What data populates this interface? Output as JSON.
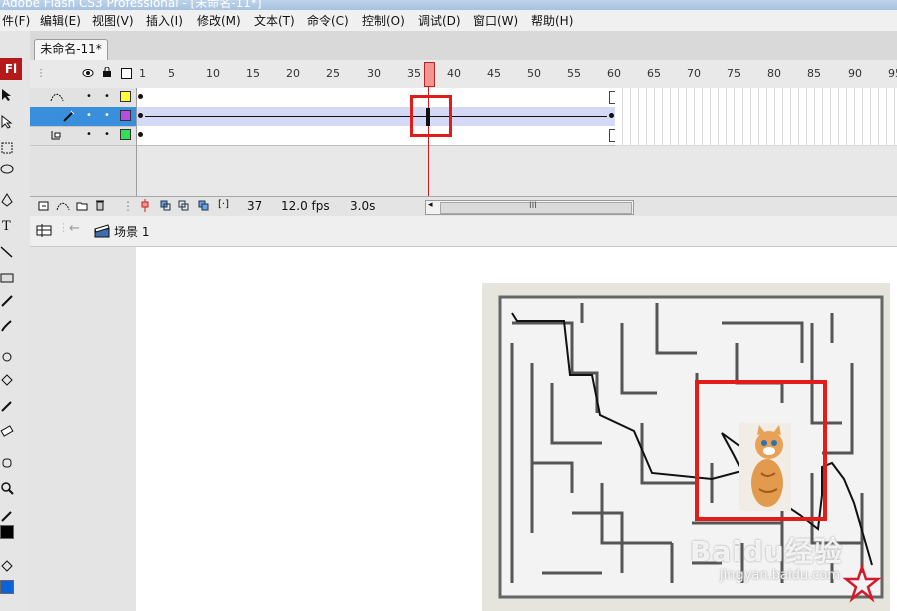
{
  "window": {
    "title": "Adobe Flash CS3 Professional - [未命名-11*]"
  },
  "menu": {
    "items": [
      "件(F)",
      "编辑(E)",
      "视图(V)",
      "插入(I)",
      "修改(M)",
      "文本(T)",
      "命令(C)",
      "控制(O)",
      "调试(D)",
      "窗口(W)",
      "帮助(H)"
    ]
  },
  "toolbox": {
    "logo": "Fl",
    "tools": [
      "selection-icon",
      "subselection-icon",
      "free-transform-icon",
      "lasso-icon",
      "pen-icon",
      "text-icon",
      "line-icon",
      "rectangle-icon",
      "pencil-icon",
      "brush-icon",
      "ink-bottle-icon",
      "paint-bucket-icon",
      "eyedropper-icon",
      "eraser-icon",
      "hand-icon",
      "zoom-icon"
    ]
  },
  "document": {
    "tab_label": "未命名-11*"
  },
  "timeline": {
    "ruler": [
      "1",
      "5",
      "10",
      "15",
      "20",
      "25",
      "30",
      "35",
      "40",
      "45",
      "50",
      "55",
      "60",
      "65",
      "70",
      "75",
      "80",
      "85",
      "90",
      "95"
    ],
    "current_frame": "37",
    "fps": "12.0 fps",
    "time": "3.0s",
    "scroll_mark": "III",
    "layers": [
      {
        "icon": "motion-guide-icon",
        "color": "#ffff33",
        "selected": false
      },
      {
        "icon": "pencil-layer-icon",
        "color": "#b44ee0",
        "selected": true
      },
      {
        "icon": "guided-layer-icon",
        "color": "#33dd55",
        "selected": false
      }
    ]
  },
  "editbar": {
    "scene_label": "场景 1"
  },
  "watermark": {
    "brand": "Baidu经验",
    "url": "jingyan.baidu.com"
  },
  "colors": {
    "highlight": "#e21b1b",
    "selected_layer": "#3a8fdc",
    "playhead": "#f2948f"
  }
}
